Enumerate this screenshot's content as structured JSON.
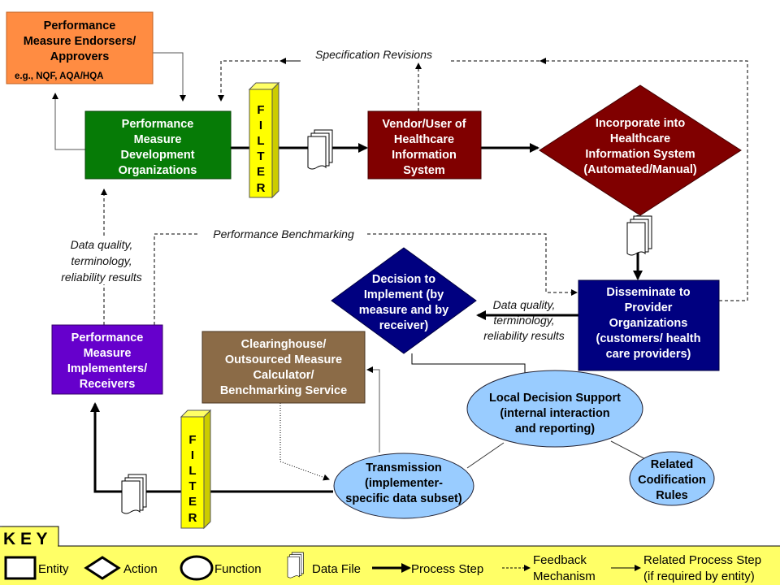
{
  "nodes": {
    "endorsers": {
      "lines": [
        "Performance",
        "Measure Endorsers/",
        "Approvers"
      ],
      "example": "e.g., NQF, AQA/HQA",
      "color": "#FF8C42"
    },
    "development": {
      "lines": [
        "Performance",
        "Measure",
        "Development",
        "Organizations"
      ],
      "color": "#067B06"
    },
    "filter_top": {
      "letters": [
        "F",
        "I",
        "L",
        "T",
        "E",
        "R"
      ],
      "color": "#FFFF00"
    },
    "vendor": {
      "lines": [
        "Vendor/User of",
        "Healthcare",
        "Information",
        "System"
      ],
      "color": "#800000"
    },
    "incorporate": {
      "lines": [
        "Incorporate into",
        "Healthcare",
        "Information System",
        "(Automated/Manual)"
      ],
      "color": "#800000"
    },
    "disseminate": {
      "lines": [
        "Disseminate to",
        "Provider",
        "Organizations",
        "(customers/ health",
        "care providers)"
      ],
      "color": "#000080"
    },
    "decision": {
      "lines": [
        "Decision to",
        "Implement (by",
        "measure and by",
        "receiver)"
      ],
      "color": "#000080"
    },
    "implementers": {
      "lines": [
        "Performance",
        "Measure",
        "Implementers/",
        "Receivers"
      ],
      "color": "#6600CC"
    },
    "clearinghouse": {
      "lines": [
        "Clearinghouse/",
        "Outsourced Measure",
        "Calculator/",
        "Benchmarking Service"
      ],
      "color": "#8B6B47"
    },
    "filter_bottom": {
      "letters": [
        "F",
        "I",
        "L",
        "T",
        "E",
        "R"
      ],
      "color": "#FFFF00"
    },
    "local_decision": {
      "lines": [
        "Local Decision Support",
        "(internal interaction",
        "and reporting)"
      ],
      "color": "#99CCFF"
    },
    "transmission": {
      "lines": [
        "Transmission",
        "(implementer-",
        "specific data subset)"
      ],
      "color": "#99CCFF"
    },
    "codification": {
      "lines": [
        "Related",
        "Codification",
        "Rules"
      ],
      "color": "#99CCFF"
    }
  },
  "labels": {
    "spec_revisions": "Specification Revisions",
    "benchmarking": "Performance Benchmarking",
    "data_quality_left": [
      "Data quality,",
      "terminology,",
      "reliability results"
    ],
    "data_quality_right": [
      "Data quality,",
      "terminology,",
      "reliability results"
    ]
  },
  "key": {
    "title": "K E Y",
    "background": "#FFFF66",
    "items": {
      "entity": "Entity",
      "action": "Action",
      "function": "Function",
      "data_file": "Data File",
      "process_step": "Process Step",
      "feedback": [
        "Feedback",
        "Mechanism"
      ],
      "related": [
        "Related Process Step",
        "(if required by entity)"
      ]
    }
  }
}
